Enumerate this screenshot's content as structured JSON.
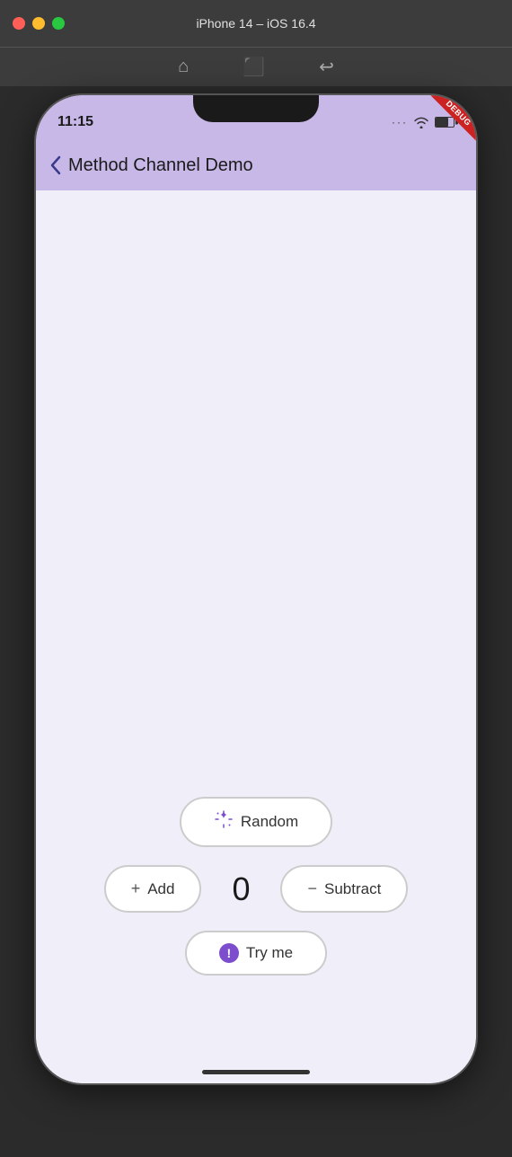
{
  "window": {
    "title": "iPhone 14 – iOS 16.4"
  },
  "toolbar": {
    "home_icon": "⌂",
    "screenshot_icon": "📷",
    "rotate_icon": "↩"
  },
  "status_bar": {
    "time": "11:15"
  },
  "app_bar": {
    "back_label": "‹",
    "title": "Method Channel Demo"
  },
  "debug_badge": "DEBUG",
  "counter": {
    "value": "0"
  },
  "buttons": {
    "random_label": "Random",
    "add_label": "Add",
    "subtract_label": "Subtract",
    "try_me_label": "Try me"
  }
}
